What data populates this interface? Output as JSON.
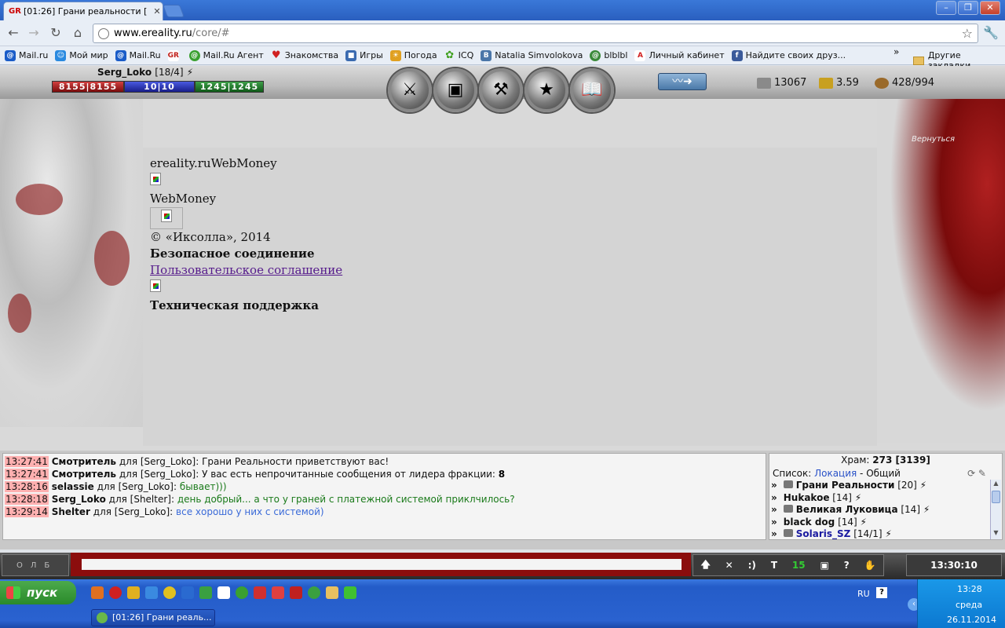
{
  "browser": {
    "tab_title": "[01:26] Грани реальности [",
    "tab_close": "✕",
    "url_host": "www.ereality.ru",
    "url_path": "/core/#",
    "bookmarks": [
      {
        "label": "Mail.ru",
        "color": "#1a5cc8"
      },
      {
        "label": "Мой мир",
        "color": "#2a8ae0"
      },
      {
        "label": "Mail.Ru",
        "color": "#1a5cc8"
      },
      {
        "label": "",
        "color": "#c0201a"
      },
      {
        "label": "Mail.Ru Агент",
        "color": "#3aa030"
      },
      {
        "label": "Знакомства",
        "color": "#d02020"
      },
      {
        "label": "Игры",
        "color": "#3a6ab0"
      },
      {
        "label": "Погода",
        "color": "#e0a020"
      },
      {
        "label": "ICQ",
        "color": "#40a020"
      },
      {
        "label": "Natalia Simvolokova",
        "color": "#4a76a8"
      },
      {
        "label": "blblbl",
        "color": "#3a8a3a"
      },
      {
        "label": "Личный кабинет",
        "color": "#d02020"
      },
      {
        "label": "Найдите своих друз...",
        "color": "#3a5a9a"
      }
    ],
    "bookmarks_more": "»",
    "other_bookmarks": "Другие закладки"
  },
  "game": {
    "player_name": "Serg_Loko",
    "player_level": "[18/4]",
    "hp": "8155|8155",
    "mp": "10|10",
    "stamina": "1245|1245",
    "resources": [
      {
        "value": "13067",
        "color": "#8a8a8a"
      },
      {
        "value": "3.59",
        "color": "#c8a020"
      },
      {
        "value": "428/994",
        "color": "#9a6a2a"
      }
    ],
    "right_label": "Вернуться",
    "content": {
      "line1": "ereality.ruWebMoney",
      "line2": "WebMoney",
      "line3": "© «Иксолла», 2014",
      "line4": "Безопасное соединение",
      "link": "Пользовательское соглашение",
      "line5": "Техническая поддержка"
    }
  },
  "chat": {
    "messages": [
      {
        "time": "13:27:41",
        "nick": "Смотритель",
        "to": " для [Serg_Loko]: ",
        "text": "Грани Реальности приветствуют вас!",
        "color": "normal",
        "extra": ""
      },
      {
        "time": "13:27:41",
        "nick": "Смотритель",
        "to": " для [Serg_Loko]: ",
        "text": "У вас есть непрочитанные сообщения от лидера фракции: ",
        "color": "normal",
        "extra": "8"
      },
      {
        "time": "13:28:16",
        "nick": "selassie",
        "to": " для [Serg_Loko]: ",
        "text": "бывает)))",
        "color": "green",
        "extra": ""
      },
      {
        "time": "13:28:18",
        "nick": "Serg_Loko",
        "to": " для [Shelter]: ",
        "text": "день добрый... а что у граней с платежной системой приклчилось?",
        "color": "green",
        "extra": ""
      },
      {
        "time": "13:29:14",
        "nick": "Shelter",
        "to": " для [Serg_Loko]: ",
        "text": "все хорошо у них с системой)",
        "color": "blue",
        "extra": ""
      }
    ],
    "temple_label": "Храм: ",
    "temple_value": "273 [3139]",
    "list_label": "Список: ",
    "list_location": "Локация",
    "list_suffix": " - Общий",
    "users": [
      {
        "name": "Грани Реальности",
        "level": " [20]",
        "blue": false
      },
      {
        "name": "Hukakoe",
        "level": " [14]",
        "blue": false
      },
      {
        "name": "Великая Луковица",
        "level": " [14]",
        "blue": false
      },
      {
        "name": "black dog",
        "level": " [14]",
        "blue": false
      },
      {
        "name": "Solaris_SZ",
        "level": " [14/1]",
        "blue": true
      }
    ],
    "clock": "13:30:10",
    "tool_count": "15"
  },
  "taskbar": {
    "start_label": "пуск",
    "task_label": "[01:26] Грани реаль...",
    "lang": "RU",
    "time": "13:28",
    "day": "среда",
    "date": "26.11.2014"
  }
}
